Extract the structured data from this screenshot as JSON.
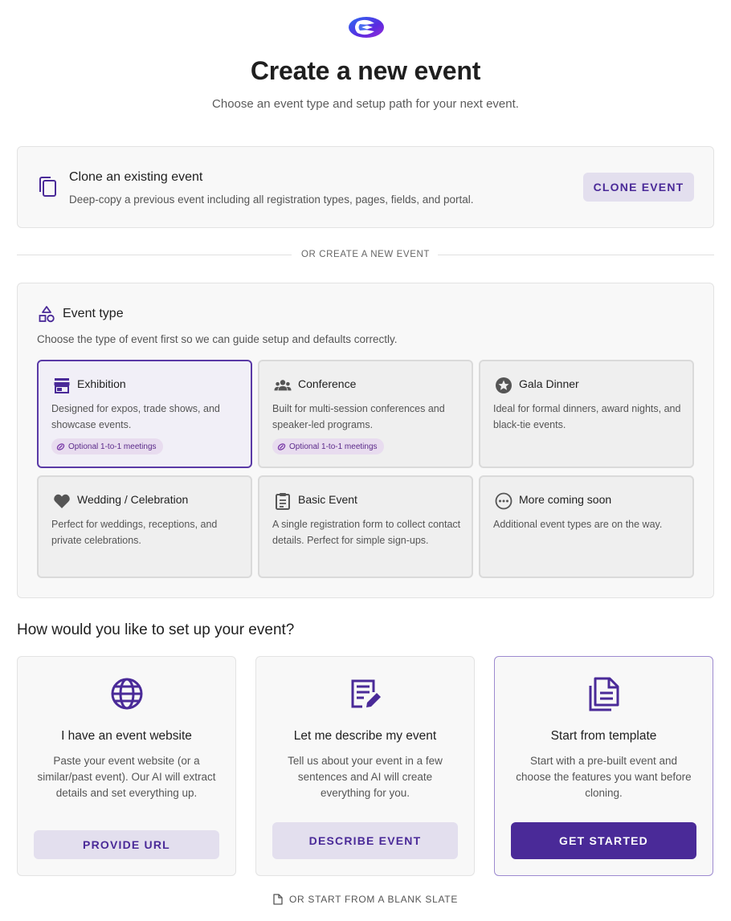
{
  "header": {
    "title": "Create a new event",
    "subtitle": "Choose an event type and setup path for your next event."
  },
  "clone": {
    "title": "Clone an existing event",
    "description": "Deep-copy a previous event including all registration types, pages, fields, and portal.",
    "button_label": "CLONE EVENT",
    "icon": "copy-icon"
  },
  "divider_text": "OR CREATE A NEW EVENT",
  "event_type": {
    "title": "Event type",
    "description": "Choose the type of event first so we can guide setup and defaults correctly.",
    "icon": "shapes-icon",
    "cards": [
      {
        "name": "Exhibition",
        "description": "Designed for expos, trade shows, and showcase events.",
        "badge": "Optional 1-to-1 meetings",
        "icon": "storefront-icon",
        "selected": true
      },
      {
        "name": "Conference",
        "description": "Built for multi-session conferences and speaker-led programs.",
        "badge": "Optional 1-to-1 meetings",
        "icon": "groups-icon",
        "selected": false
      },
      {
        "name": "Gala Dinner",
        "description": "Ideal for formal dinners, award nights, and black-tie events.",
        "icon": "star-icon",
        "selected": false
      },
      {
        "name": "Wedding / Celebration",
        "description": "Perfect for weddings, receptions, and private celebrations.",
        "icon": "heart-icon",
        "selected": false
      },
      {
        "name": "Basic Event",
        "description": "A single registration form to collect contact details. Perfect for simple sign-ups.",
        "icon": "clipboard-icon",
        "selected": false
      },
      {
        "name": "More coming soon",
        "description": "Additional event types are on the way.",
        "icon": "more-icon",
        "selected": false
      }
    ]
  },
  "setup": {
    "heading": "How would you like to set up your event?",
    "options": [
      {
        "title": "I have an event website",
        "description": "Paste your event website (or a similar/past event). Our AI will extract details and set everything up.",
        "button_label": "PROVIDE URL",
        "icon": "globe-icon"
      },
      {
        "title": "Let me describe my event",
        "description": "Tell us about your event in a few sentences and AI will create everything for you.",
        "button_label": "DESCRIBE EVENT",
        "icon": "edit-note-icon"
      },
      {
        "title": "Start from template",
        "description": "Start with a pre-built event and choose the features you want before cloning.",
        "button_label": "GET STARTED",
        "icon": "document-copy-icon"
      }
    ]
  },
  "blank_slate_label": "OR START FROM A BLANK SLATE",
  "colors": {
    "accent": "#4a2a98",
    "accent_light": "#e3dfee",
    "badge_bg": "#e8dcef"
  }
}
